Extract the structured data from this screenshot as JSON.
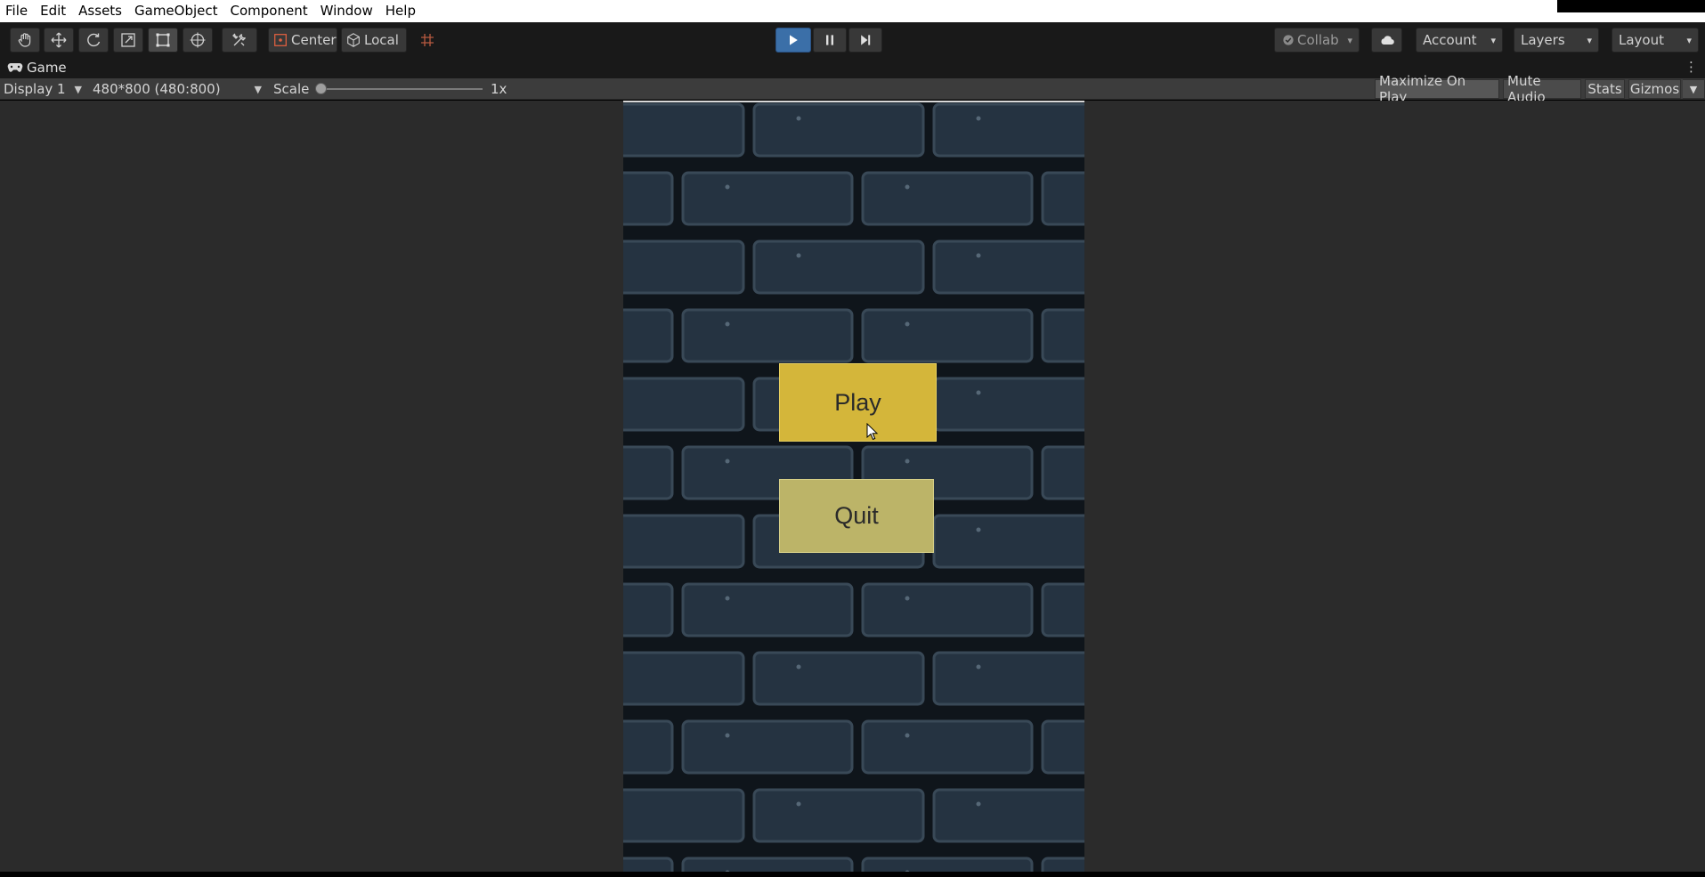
{
  "menubar": {
    "items": [
      "File",
      "Edit",
      "Assets",
      "GameObject",
      "Component",
      "Window",
      "Help"
    ]
  },
  "toolbar": {
    "tools": [
      "hand-tool",
      "move-tool",
      "rotate-tool",
      "scale-tool",
      "rect-tool",
      "transform-tool",
      "custom-editor-tool"
    ],
    "active_tool": "rect-tool",
    "pivot_label": "Center",
    "space_label": "Local",
    "collab_label": "Collab",
    "account_label": "Account",
    "layers_label": "Layers",
    "layout_label": "Layout",
    "play_state": "playing"
  },
  "tab": {
    "title": "Game"
  },
  "gamebar": {
    "display": "Display 1",
    "resolution": "480*800 (480:800)",
    "scale_label": "Scale",
    "scale_value": "1x",
    "scale_fraction": 0.0,
    "maximize_label": "Maximize On Play",
    "mute_label": "Mute Audio",
    "stats_label": "Stats",
    "gizmos_label": "Gizmos"
  },
  "game": {
    "play_label": "Play",
    "quit_label": "Quit",
    "colors": {
      "play": "#d4b63a",
      "quit": "#bcb468",
      "brick": "#2e3f50",
      "mortar": "#131a22"
    }
  },
  "colors": {
    "accent": "#3b6fa8"
  }
}
